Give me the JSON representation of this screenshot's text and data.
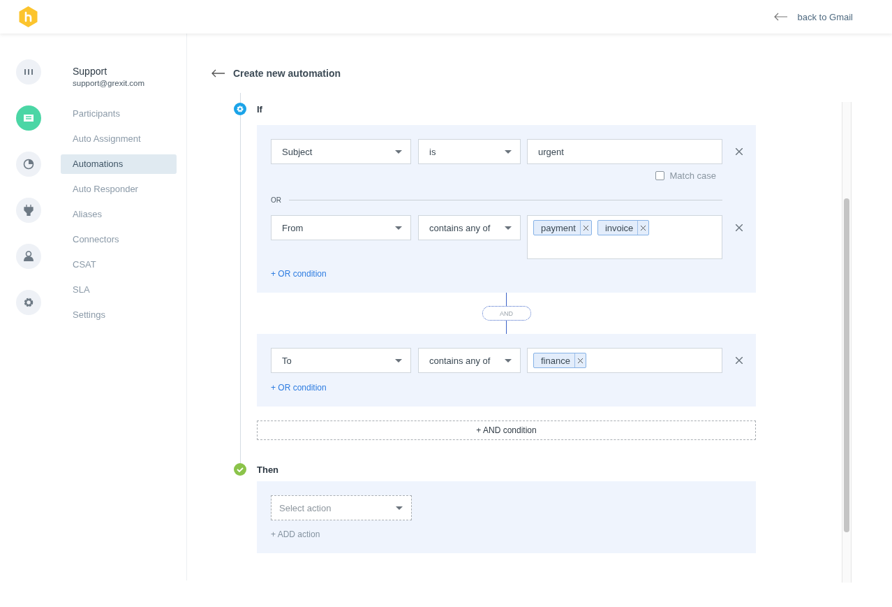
{
  "header": {
    "back_link": "back to Gmail"
  },
  "rail": [
    {
      "kind": "chart",
      "selected": false
    },
    {
      "kind": "inbox",
      "selected": true
    },
    {
      "kind": "pie",
      "selected": false
    },
    {
      "kind": "plug",
      "selected": false
    },
    {
      "kind": "person",
      "selected": false
    },
    {
      "kind": "gear",
      "selected": false
    }
  ],
  "sidebar": {
    "title": "Support",
    "email": "support@grexit.com",
    "items": [
      {
        "label": "Participants",
        "selected": false
      },
      {
        "label": "Auto Assignment",
        "selected": false
      },
      {
        "label": "Automations",
        "selected": true
      },
      {
        "label": "Auto Responder",
        "selected": false
      },
      {
        "label": "Aliases",
        "selected": false
      },
      {
        "label": "Connectors",
        "selected": false
      },
      {
        "label": "CSAT",
        "selected": false
      },
      {
        "label": "SLA",
        "selected": false
      },
      {
        "label": "Settings",
        "selected": false
      }
    ]
  },
  "main": {
    "title": "Create new automation",
    "if_label": "If",
    "groups": [
      {
        "conditions": [
          {
            "kind": "text",
            "field": "Subject",
            "operator": "is",
            "value": "urgent",
            "match_case": {
              "label": "Match case",
              "checked": false
            }
          },
          {
            "kind": "tags",
            "join": "OR",
            "field": "From",
            "operator": "contains any of",
            "tags": [
              "payment",
              "invoice"
            ]
          }
        ],
        "or_button": "+ OR condition"
      },
      {
        "conditions": [
          {
            "kind": "tags",
            "field": "To",
            "operator": "contains any of",
            "tags": [
              "finance"
            ]
          }
        ],
        "or_button": "+ OR condition"
      }
    ],
    "and_label": "AND",
    "and_button": "+ AND condition",
    "then_label": "Then",
    "action": {
      "placeholder": "Select action"
    },
    "add_action": "+ ADD action"
  }
}
